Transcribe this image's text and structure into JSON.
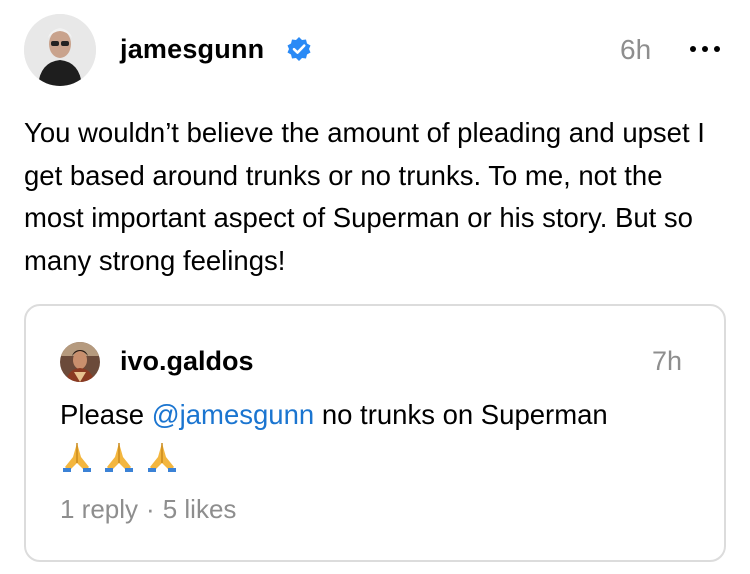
{
  "post": {
    "username": "jamesgunn",
    "verified": true,
    "time": "6h",
    "text": "You wouldn’t believe the amount of pleading and upset I get based around trunks or no trunks. To me, not the most important aspect of Superman or his story. But so many strong feelings!",
    "icons": {
      "verified": "verified-badge-icon",
      "more": "more-options-icon"
    },
    "colors": {
      "verified": "#2a8af6",
      "secondary_text": "#8e8e8e"
    }
  },
  "quoted_post": {
    "username": "ivo.galdos",
    "time": "7h",
    "text_before": "Please ",
    "mention": "@jamesgunn",
    "text_after": " no trunks on Superman",
    "emojis": [
      "🙏",
      "🙏",
      "🙏"
    ],
    "replies": "1 reply",
    "separator": "·",
    "likes": "5 likes",
    "colors": {
      "mention": "#1b75d0",
      "border": "#dcdcdc"
    }
  }
}
